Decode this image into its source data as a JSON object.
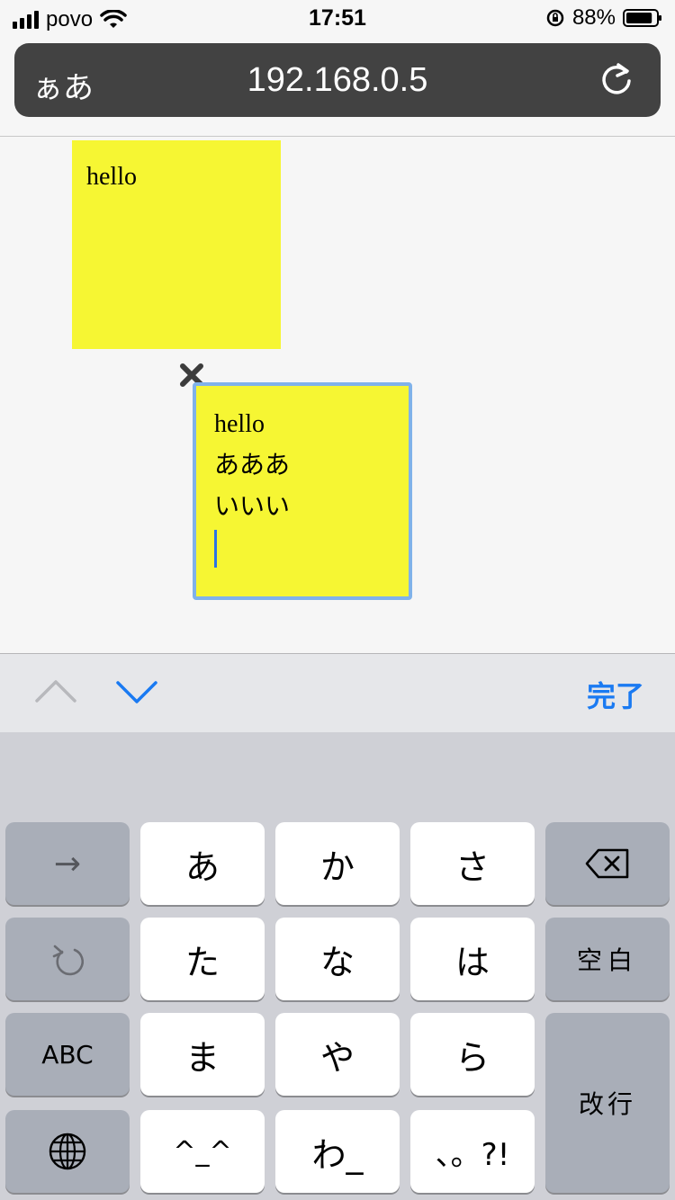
{
  "status_bar": {
    "carrier": "povo",
    "time": "17:51",
    "battery": "88%",
    "battery_level": 0.88
  },
  "url_bar": {
    "reader_label": "ぁあ",
    "url": "192.168.0.5",
    "reload_icon": "reload-icon"
  },
  "notes": [
    {
      "lines": [
        "hello"
      ]
    },
    {
      "lines": [
        "hello",
        "あああ",
        "いいい"
      ]
    }
  ],
  "close_icon": "close-icon",
  "accessory": {
    "prev_icon": "chevron-up-icon",
    "next_icon": "chevron-down-icon",
    "done_label": "完了"
  },
  "keyboard": {
    "keys": {
      "next": "→",
      "a": "あ",
      "ka": "か",
      "sa": "さ",
      "ta": "た",
      "na": "な",
      "ha": "は",
      "space": "空白",
      "abc": "ABC",
      "ma": "ま",
      "ya": "や",
      "ra": "ら",
      "return": "改行",
      "emoticon": "^_^",
      "wa": "わ_",
      "punct": "、。?!"
    },
    "icons": {
      "backspace": "backspace-icon",
      "undo": "undo-icon",
      "globe": "globe-icon"
    },
    "colors": {
      "light_key": "#ffffff",
      "dark_key": "#a9aeb8",
      "background": "#cfd0d6"
    }
  }
}
